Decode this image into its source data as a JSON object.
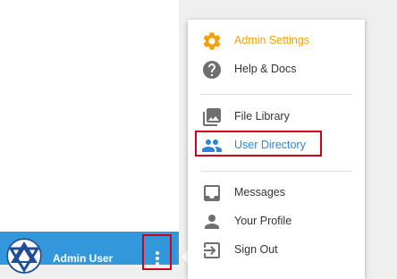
{
  "user": {
    "name": "Admin User",
    "avatar_icon": "spider-logo-icon",
    "menu_icon": "more-vertical-icon"
  },
  "menu": {
    "items": [
      {
        "label": "Admin Settings",
        "icon": "gear-icon",
        "state": "active"
      },
      {
        "label": "Help & Docs",
        "icon": "help-circle-icon"
      },
      {
        "label": "File Library",
        "icon": "image-library-icon"
      },
      {
        "label": "User Directory",
        "icon": "people-icon",
        "state": "highlighted"
      },
      {
        "label": "Messages",
        "icon": "inbox-icon"
      },
      {
        "label": "Your Profile",
        "icon": "person-icon"
      },
      {
        "label": "Sign Out",
        "icon": "sign-out-icon"
      }
    ]
  },
  "colors": {
    "accent_orange": "#f5a00b",
    "link_blue": "#2f86d6",
    "user_bar_blue": "#3398db",
    "highlight_red": "#d0021b",
    "icon_gray": "#6f6f6f"
  }
}
